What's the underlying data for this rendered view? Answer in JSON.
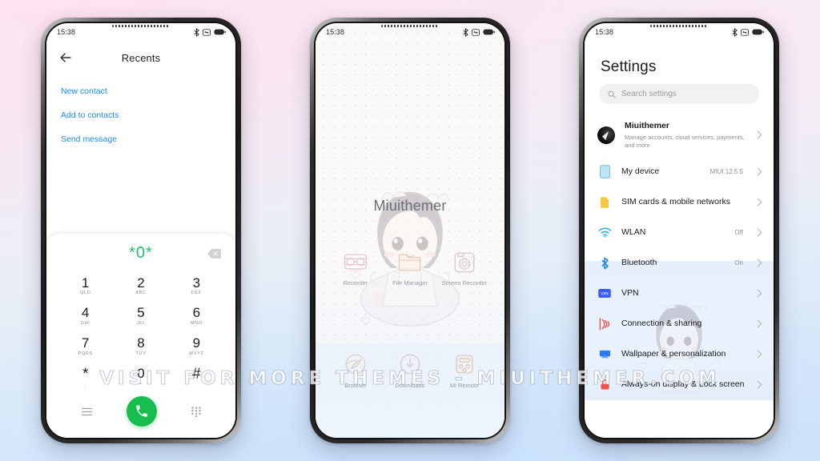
{
  "watermark": "VISIT FOR MORE THEMES - MIUITHEMER.COM",
  "status_bar": {
    "time": "15:38",
    "icons": [
      "bluetooth-icon",
      "mute-icon",
      "battery-icon"
    ]
  },
  "phone_dialer": {
    "header": {
      "back": "back-arrow-icon",
      "title": "Recents"
    },
    "links": [
      "New contact",
      "Add to contacts",
      "Send message"
    ],
    "dial_display": {
      "number": "*0*",
      "backspace": "backspace-icon"
    },
    "keys": [
      {
        "num": "1",
        "sub": "QLD"
      },
      {
        "num": "2",
        "sub": "ABC"
      },
      {
        "num": "3",
        "sub": "DEF"
      },
      {
        "num": "4",
        "sub": "GHI"
      },
      {
        "num": "5",
        "sub": "JKL"
      },
      {
        "num": "6",
        "sub": "MNO"
      },
      {
        "num": "7",
        "sub": "PQRS"
      },
      {
        "num": "8",
        "sub": "TUV"
      },
      {
        "num": "9",
        "sub": "WXYZ"
      },
      {
        "num": "*",
        "sub": ","
      },
      {
        "num": "0",
        "sub": "+"
      },
      {
        "num": "#",
        "sub": ""
      }
    ],
    "actions": {
      "menu": "menu-icon",
      "call": "call-icon",
      "keypad": "keypad-icon"
    },
    "accent_green": "#18bd4d",
    "link_blue": "#1a8cf0"
  },
  "phone_home": {
    "wallpaper_title": "Miuithemer",
    "apps": [
      {
        "label": "Recorder",
        "icon": "recorder-icon"
      },
      {
        "label": "File Manager",
        "icon": "folder-icon"
      },
      {
        "label": "Screen Recorder",
        "icon": "screen-recorder-icon"
      },
      {
        "label": "Browser",
        "icon": "browser-icon"
      },
      {
        "label": "Downloads",
        "icon": "downloads-icon"
      },
      {
        "label": "Mi Remote",
        "icon": "remote-icon"
      }
    ]
  },
  "phone_settings": {
    "title": "Settings",
    "search": {
      "placeholder": "Search settings",
      "icon": "search-icon"
    },
    "account": {
      "name": "Miuithemer",
      "desc": "Manage accounts, cloud services, payments, and more",
      "avatar": "avatar"
    },
    "items": [
      {
        "label": "My device",
        "value": "MIUI 12.5.5",
        "icon": "device-icon",
        "color": "#a7d8f0"
      },
      {
        "label": "SIM cards & mobile networks",
        "value": "",
        "icon": "sim-icon",
        "color": "#f5c542"
      },
      {
        "label": "WLAN",
        "value": "Off",
        "icon": "wifi-icon",
        "color": "#29b6f6"
      },
      {
        "label": "Bluetooth",
        "value": "On",
        "icon": "bluetooth-icon",
        "color": "#2196f3"
      },
      {
        "label": "VPN",
        "value": "",
        "icon": "vpn-icon",
        "color": "#3d5afe"
      },
      {
        "label": "Connection & sharing",
        "value": "",
        "icon": "connection-icon",
        "color": "#ef5350"
      },
      {
        "label": "Wallpaper & personalization",
        "value": "",
        "icon": "wallpaper-icon",
        "color": "#2979ff"
      },
      {
        "label": "Always-on display & Lock screen",
        "value": "",
        "icon": "lock-icon",
        "color": "#ef5350"
      }
    ]
  }
}
